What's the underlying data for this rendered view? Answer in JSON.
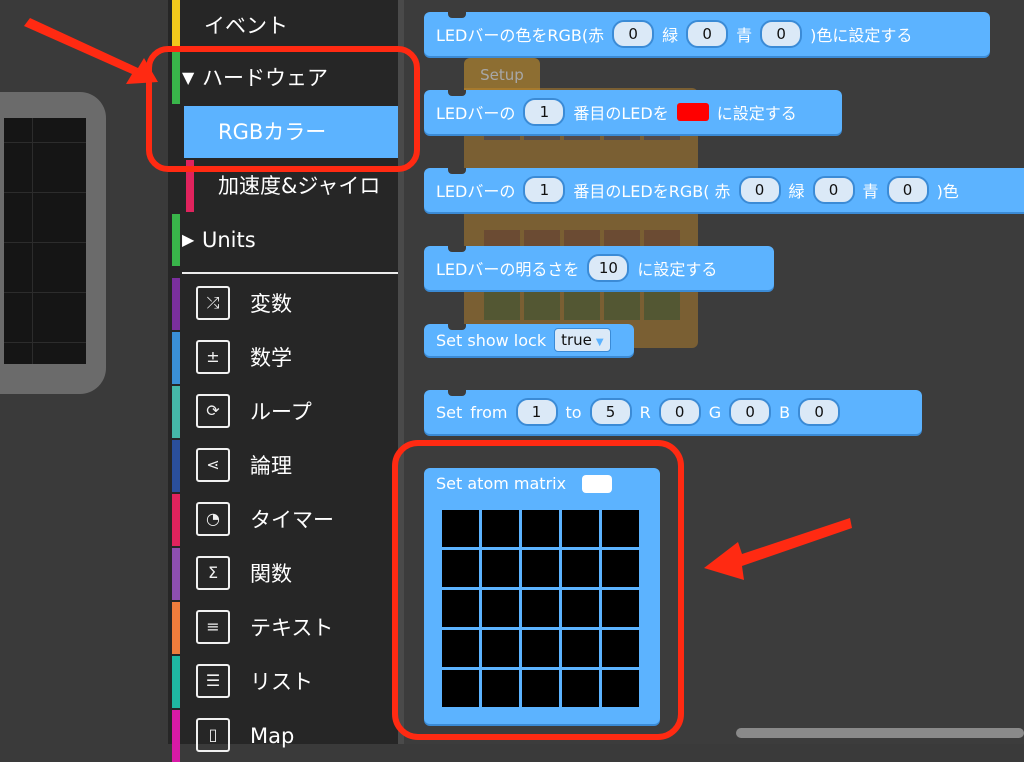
{
  "sidebar": {
    "event": "イベント",
    "hardware_expanded": "▼",
    "hardware": "ハードウェア",
    "rgb_color": "RGBカラー",
    "accel_gyro": "加速度&ジャイロ",
    "units_collapsed": "▶",
    "units": "Units",
    "categories": [
      {
        "label": "変数",
        "icon": "shuffle-icon",
        "color": "#7b2f9e"
      },
      {
        "label": "数学",
        "icon": "calculator-icon",
        "color": "#3a8fd6"
      },
      {
        "label": "ループ",
        "icon": "loop-icon",
        "color": "#45b8a8"
      },
      {
        "label": "論理",
        "icon": "branch-icon",
        "color": "#2a4f9c"
      },
      {
        "label": "タイマー",
        "icon": "stopwatch-icon",
        "color": "#e0235d"
      },
      {
        "label": "関数",
        "icon": "sigma-icon",
        "color": "#8e4fb0"
      },
      {
        "label": "テキスト",
        "icon": "text-card-icon",
        "color": "#ef7d3c"
      },
      {
        "label": "リスト",
        "icon": "list-icon",
        "color": "#1fb8a2"
      },
      {
        "label": "Map",
        "icon": "map-icon",
        "color": "#d81aa6"
      }
    ]
  },
  "blocks": {
    "b1": {
      "prefix": "LEDバーの色をRGB(赤",
      "r": "0",
      "g_label": "緑",
      "g": "0",
      "b_label": "青",
      "b": "0",
      "suffix": ")色に設定する"
    },
    "setup_label": "Setup",
    "b2": {
      "prefix": "LEDバーの",
      "n": "1",
      "mid": "番目のLEDを",
      "suffix": "に設定する",
      "color": "#ff0000"
    },
    "b3": {
      "prefix": "LEDバーの",
      "n": "1",
      "mid": "番目のLEDをRGB( 赤",
      "r": "0",
      "g_label": "緑",
      "g": "0",
      "b_label": "青",
      "b": "0",
      "suffix": ")色"
    },
    "b4": {
      "prefix": "LEDバーの明るさを",
      "v": "10",
      "suffix": "に設定する"
    },
    "b5": {
      "label": "Set show lock",
      "value": "true"
    },
    "b6": {
      "set": "Set",
      "from": "from",
      "from_v": "1",
      "to": "to",
      "to_v": "5",
      "r_label": "R",
      "r": "0",
      "g_label": "G",
      "g": "0",
      "b_label": "B",
      "b": "0"
    },
    "b7": {
      "label": "Set atom matrix"
    }
  },
  "colors": {
    "block": "#5cb3ff",
    "highlight": "#ff2a12",
    "sidebar": "#262626"
  }
}
